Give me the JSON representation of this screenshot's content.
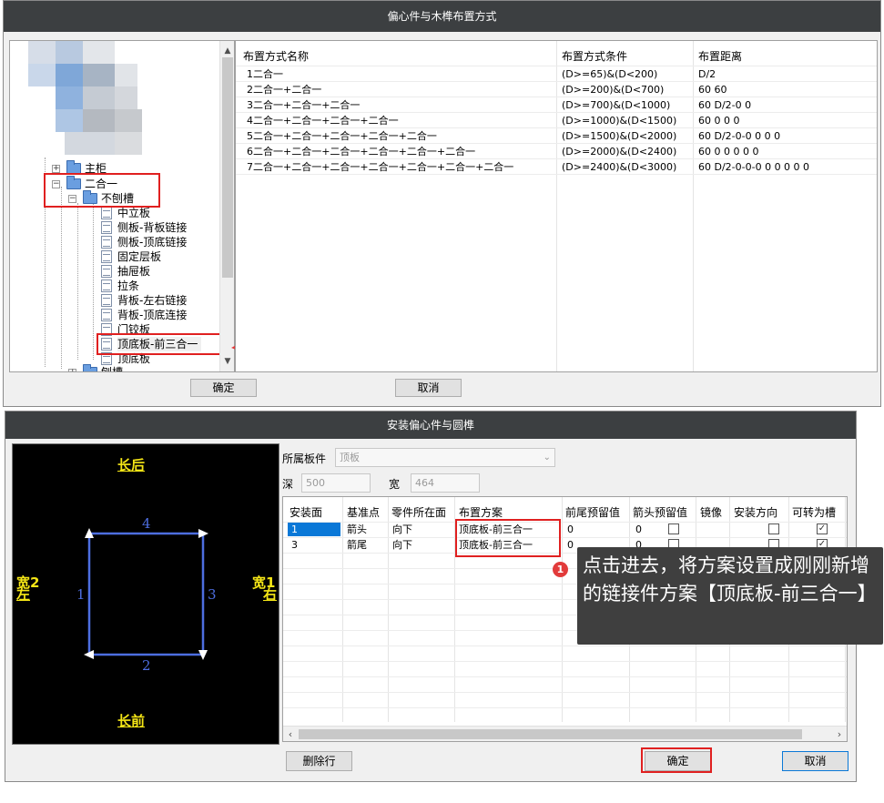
{
  "dialog1": {
    "title": "偏心件与木榫布置方式",
    "tree": {
      "nodes": [
        {
          "label": "主柜",
          "expander": "+"
        },
        {
          "label": "二合一",
          "expander": "−"
        },
        {
          "label": "不刨槽",
          "expander": "−"
        },
        {
          "label": "中立板"
        },
        {
          "label": "侧板-背板链接"
        },
        {
          "label": "侧板-顶底链接"
        },
        {
          "label": "固定层板"
        },
        {
          "label": "抽屉板"
        },
        {
          "label": "拉条"
        },
        {
          "label": "背板-左右链接"
        },
        {
          "label": "背板-顶底连接"
        },
        {
          "label": "门铰板"
        },
        {
          "label": "顶底板-前三合一"
        },
        {
          "label": "顶底板"
        },
        {
          "label": "刨槽",
          "expander": "+"
        }
      ]
    },
    "grid": {
      "columns": [
        "布置方式名称",
        "布置方式条件",
        "布置距离"
      ],
      "rows": [
        [
          "1二合一",
          "(D>=65)&(D<200)",
          "D/2"
        ],
        [
          "2二合一+二合一",
          "(D>=200)&(D<700)",
          "60 60"
        ],
        [
          "3二合一+二合一+二合一",
          "(D>=700)&(D<1000)",
          "60 D/2-0 0"
        ],
        [
          "4二合一+二合一+二合一+二合一",
          "(D>=1000)&(D<1500)",
          "60 0 0 0"
        ],
        [
          "5二合一+二合一+二合一+二合一+二合一",
          "(D>=1500)&(D<2000)",
          "60 D/2-0-0 0 0 0"
        ],
        [
          "6二合一+二合一+二合一+二合一+二合一+二合一",
          "(D>=2000)&(D<2400)",
          "60 0 0 0 0 0"
        ],
        [
          "7二合一+二合一+二合一+二合一+二合一+二合一+二合一",
          "(D>=2400)&(D<3000)",
          "60 D/2-0-0-0 0 0 0 0 0"
        ]
      ]
    },
    "buttons": {
      "ok": "确定",
      "cancel": "取消"
    }
  },
  "dialog2": {
    "title": "安装偏心件与圆榫",
    "preview": {
      "top_label": "长后",
      "bottom_label": "长前",
      "left_label_top": "宽2",
      "left_label_bottom": "左",
      "right_label_top": "宽1",
      "right_label_bottom": "右",
      "edge_top": "4",
      "edge_bottom": "2",
      "edge_left": "1",
      "edge_right": "3"
    },
    "form": {
      "board_label": "所属板件",
      "board_value": "顶板",
      "depth_label": "深",
      "depth_value": "500",
      "width_label": "宽",
      "width_value": "464"
    },
    "grid": {
      "columns": [
        "安装面",
        "基准点",
        "零件所在面",
        "布置方案",
        "前尾预留值",
        "箭头预留值",
        "镜像",
        "安装方向",
        "可转为槽"
      ],
      "rows": [
        {
          "face": "1",
          "ref": "箭头",
          "part_face": "向下",
          "scheme": "顶底板-前三合一",
          "tail_reserve": "0",
          "head_reserve": "0",
          "mirror_checked": false,
          "direction_checked": false,
          "slot_checked": true
        },
        {
          "face": "3",
          "ref": "箭尾",
          "part_face": "向下",
          "scheme": "顶底板-前三合一",
          "tail_reserve": "0",
          "head_reserve": "0",
          "mirror_checked": false,
          "direction_checked": false,
          "slot_checked": true
        }
      ]
    },
    "buttons": {
      "delete_row": "删除行",
      "ok": "确定",
      "cancel": "取消"
    }
  },
  "annotation": {
    "number": "1",
    "text": "点击进去，将方案设置成刚刚新增的链接件方案【顶底板-前三合一】"
  },
  "colors": {
    "highlight_red": "#e02020",
    "titlebar": "#3c3f41",
    "preview_yellow": "#f5e616",
    "preview_blue": "#4d6ee0",
    "arrow_red": "#e23b3b"
  }
}
